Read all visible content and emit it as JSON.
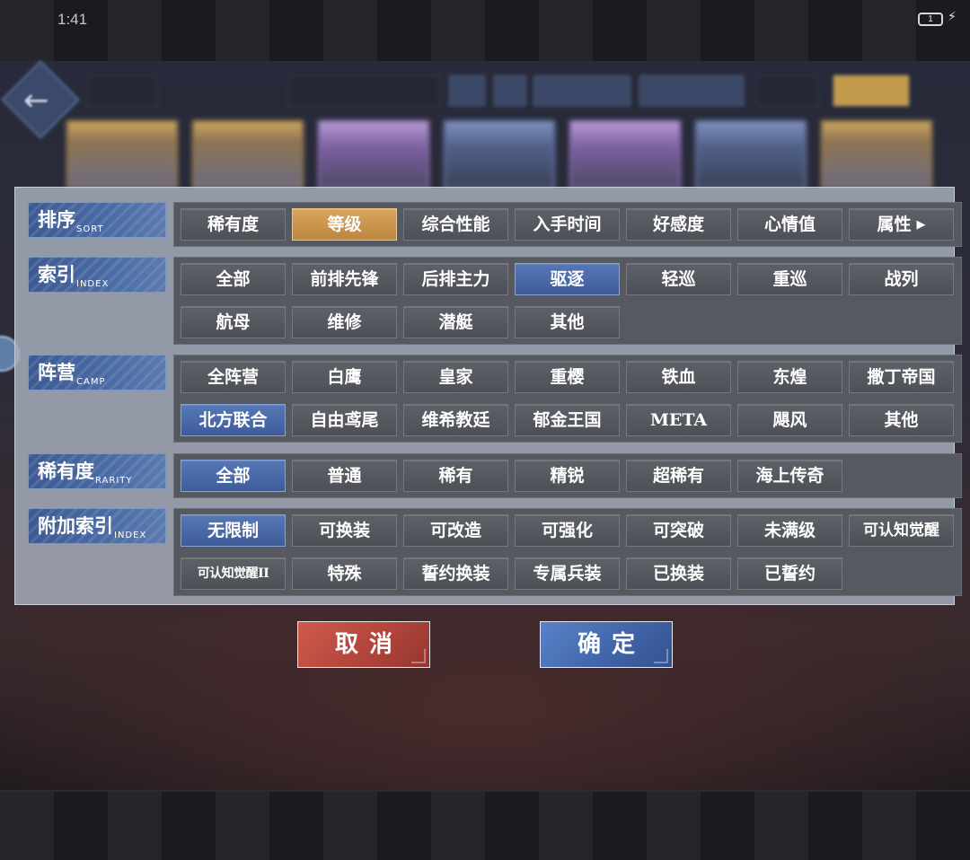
{
  "status_bar": {
    "time": "1:41",
    "battery": "1"
  },
  "filter": {
    "sort": {
      "label": "排序",
      "label_en": "SORT",
      "options": [
        "稀有度",
        "等级",
        "综合性能",
        "入手时间",
        "好感度",
        "心情值",
        "属性"
      ],
      "selected": "等级"
    },
    "index": {
      "label": "索引",
      "label_en": "INDEX",
      "options": [
        "全部",
        "前排先锋",
        "后排主力",
        "驱逐",
        "轻巡",
        "重巡",
        "战列",
        "航母",
        "维修",
        "潜艇",
        "其他"
      ],
      "selected": "驱逐"
    },
    "camp": {
      "label": "阵营",
      "label_en": "CAMP",
      "options": [
        "全阵营",
        "白鹰",
        "皇家",
        "重樱",
        "铁血",
        "东煌",
        "撒丁帝国",
        "北方联合",
        "自由鸢尾",
        "维希教廷",
        "郁金王国",
        "META",
        "飓风",
        "其他"
      ],
      "selected": "北方联合"
    },
    "rarity": {
      "label": "稀有度",
      "label_en": "RARITY",
      "options": [
        "全部",
        "普通",
        "稀有",
        "精锐",
        "超稀有",
        "海上传奇"
      ],
      "selected": "全部"
    },
    "extra": {
      "label": "附加索引",
      "label_en": "INDEX",
      "options": [
        "无限制",
        "可换装",
        "可改造",
        "可强化",
        "可突破",
        "未满级",
        "可认知觉醒",
        "可认知觉醒II",
        "特殊",
        "誓约换装",
        "专属兵装",
        "已换装",
        "已誓约"
      ],
      "selected": "无限制"
    }
  },
  "buttons": {
    "cancel": "取消",
    "confirm": "确定"
  },
  "colors": {
    "selected_blue": "#4a6aa8",
    "selected_gold": "#cd9550",
    "cancel_red": "#b84a3e",
    "confirm_blue": "#4669ad"
  }
}
